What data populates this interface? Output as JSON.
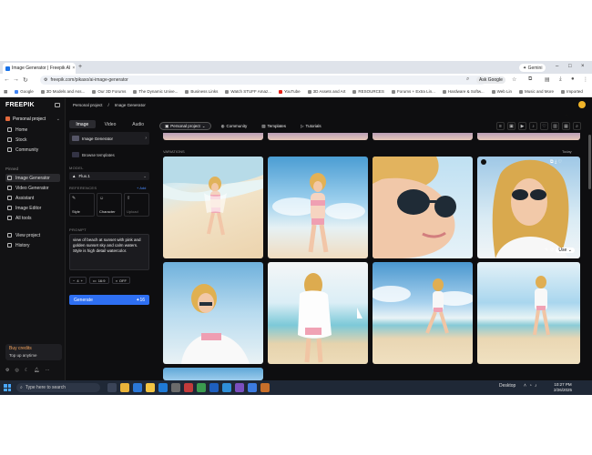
{
  "browser": {
    "tab_title": "Image Generator | Freepik AI",
    "tab_close": "×",
    "new_tab": "+",
    "gemini_label": "Gemini",
    "url": "freepik.com/pikaso/ai-image-generator",
    "ask_google": "Ask Google",
    "window_controls": [
      "–",
      "□",
      "×"
    ]
  },
  "bookmarks": [
    "Google",
    "3D Models and Ass...",
    "Our 3D Forums",
    "The Dynamic Unive...",
    "Business Links",
    "Watch STUFF Amaz...",
    "YouTube",
    "3D Assets and Art",
    "RESOURCES",
    "Forums + Extra Lin...",
    "Hardware & Softw...",
    "Web Lin",
    "Music and More",
    "Imported"
  ],
  "sidebar": {
    "logo": "FREEPIK",
    "project": "Personal project",
    "items_top": [
      {
        "label": "Home",
        "icon": "home-icon"
      },
      {
        "label": "Stock",
        "icon": "stock-icon"
      },
      {
        "label": "Community",
        "icon": "community-icon"
      }
    ],
    "pinned_label": "Pinned",
    "items_pinned": [
      {
        "label": "Image Generator",
        "icon": "image-generator-icon",
        "active": true
      },
      {
        "label": "Video Generator",
        "icon": "video-generator-icon"
      },
      {
        "label": "Assistant",
        "icon": "assistant-icon"
      },
      {
        "label": "Image Editor",
        "icon": "image-editor-icon"
      },
      {
        "label": "All tools",
        "icon": "all-tools-icon"
      }
    ],
    "items_bottom": [
      {
        "label": "View project",
        "icon": "view-project-icon"
      },
      {
        "label": "History",
        "icon": "history-icon"
      }
    ],
    "buy_credits": "Buy credits",
    "top_up": "Top up anytime"
  },
  "breadcrumb": [
    "Personal project",
    "/",
    "Image Generator"
  ],
  "panel": {
    "tabs": [
      "Image",
      "Video",
      "Audio"
    ],
    "generator": "Image Generator",
    "browse_templates": "Browse templates",
    "model_label": "MODEL",
    "model_value": "Flux.1",
    "references_label": "REFERENCES",
    "add_label": "+ Add",
    "refs": [
      "Style",
      "Character",
      "Upload"
    ],
    "prompt_label": "PROMPT",
    "prompt_text": "view of beach at sunset with pink and golden sunset sky and calm waters. Style is high detail watercolor.",
    "options": [
      "4",
      "16:9",
      "OFF"
    ],
    "generate": "Generate",
    "generate_cost": "16"
  },
  "main": {
    "project_pill": "Personal project",
    "links": [
      "Community",
      "Templates",
      "Tutorials"
    ],
    "section_label": "VARIATIONS",
    "today_label": "Today",
    "use_label": "Use"
  },
  "taskbar": {
    "search_placeholder": "Type here to search",
    "desktop_label": "Desktop",
    "time": "10:27 PM",
    "date": "2/26/2025"
  },
  "colors": {
    "accent": "#2e6ff2",
    "credits": "#f2a25b",
    "background": "#0e0e10"
  }
}
